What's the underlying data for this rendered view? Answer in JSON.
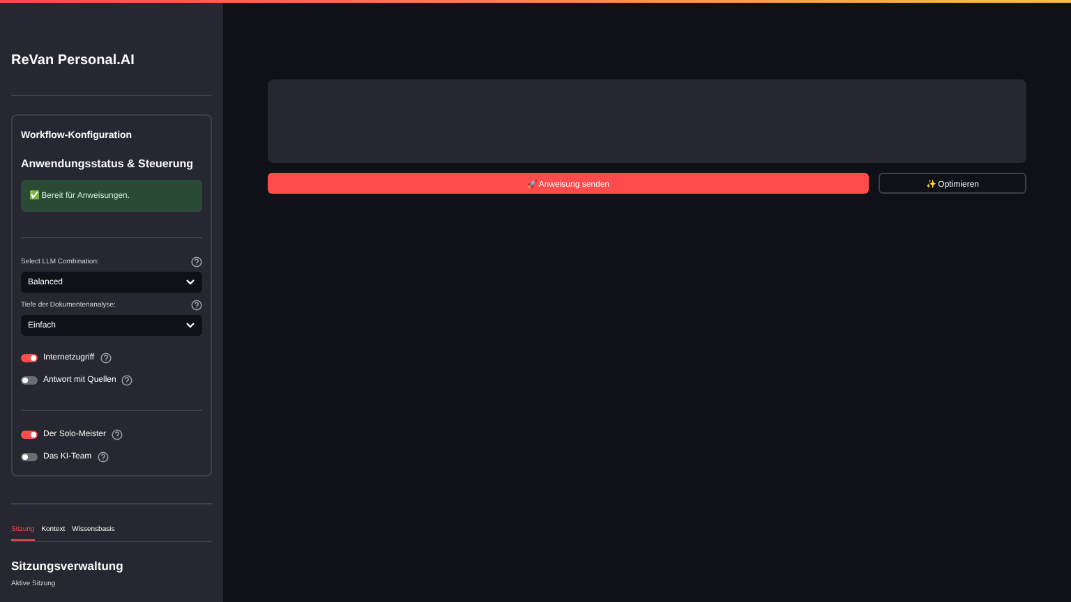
{
  "sidebar": {
    "title": "ReVan Personal.AI",
    "config_card": {
      "heading": "Workflow-Konfiguration",
      "subheading": "Anwendungsstatus & Steuerung",
      "status": "✅ Bereit für Anweisungen.",
      "selects": [
        {
          "label": "Select LLM Combination:",
          "value": "Balanced"
        },
        {
          "label": "Tiefe der Dokumentenanalyse:",
          "value": "Einfach"
        }
      ],
      "toggles": [
        {
          "label": "Internetzugriff",
          "on": true
        },
        {
          "label": "Antwort mit Quellen",
          "on": false
        }
      ],
      "mode_toggles": [
        {
          "label": "Der Solo-Meister",
          "on": true
        },
        {
          "label": "Das KI-Team",
          "on": false
        }
      ]
    },
    "tabs": [
      {
        "label": "Sitzung",
        "selected": true
      },
      {
        "label": "Kontext",
        "selected": false
      },
      {
        "label": "Wissensbasis",
        "selected": false
      }
    ],
    "section_title": "Sitzungsverwaltung",
    "field_label": "Aktive Sitzung"
  },
  "main": {
    "primary_button": "🚀 Anweisung senden",
    "secondary_button": "✨ Optimieren"
  }
}
